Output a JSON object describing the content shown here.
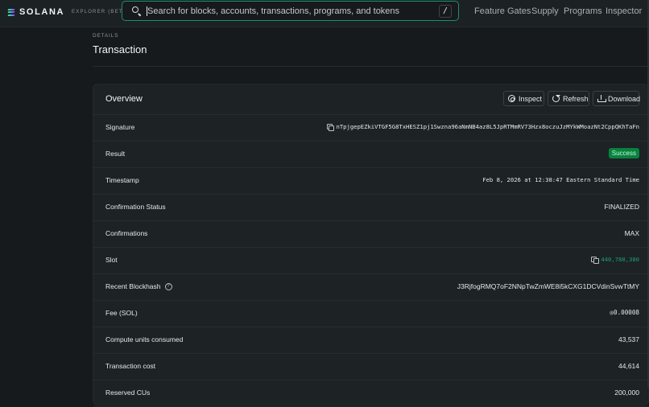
{
  "brand": {
    "name": "SOLANA",
    "sub": "EXPLORER (BETA)"
  },
  "search": {
    "placeholder": "Search for blocks, accounts, transactions, programs, and tokens",
    "shortcut": "/"
  },
  "nav": [
    {
      "label": "Feature Gates"
    },
    {
      "label": "Supply"
    },
    {
      "label": "Programs"
    },
    {
      "label": "Inspector"
    }
  ],
  "header": {
    "pretitle": "DETAILS",
    "title": "Transaction"
  },
  "card": {
    "title": "Overview",
    "buttons": {
      "inspect": "Inspect",
      "refresh": "Refresh",
      "download": "Download"
    },
    "rows": [
      {
        "label": "Signature",
        "value": "nTpjgepEZkiVTGF5G8TxHESZ1pj1Swzna96aNmNB4az8L5JpRTMmRV73Hzx8oczuJzMYkWMoazNt2CppQKhTaFn"
      },
      {
        "label": "Result",
        "value": "Success"
      },
      {
        "label": "Timestamp",
        "value": "Feb 8, 2026 at 12:38:47 Eastern Standard Time"
      },
      {
        "label": "Confirmation Status",
        "value": "FINALIZED"
      },
      {
        "label": "Confirmations",
        "value": "MAX"
      },
      {
        "label": "Slot",
        "value": "440,780,380"
      },
      {
        "label": "Recent Blockhash",
        "value": "J3RjfogRMQ7oF2NNpTwZmWE8i5kCXG1DCVdinSvwTtMY"
      },
      {
        "label": "Fee (SOL)",
        "value": "◎0.00008"
      },
      {
        "label": "Compute units consumed",
        "value": "43,537"
      },
      {
        "label": "Transaction cost",
        "value": "44,614"
      },
      {
        "label": "Reserved CUs",
        "value": "200,000"
      }
    ]
  },
  "colors": {
    "accent": "#1d9e75",
    "success_badge": "#08823f",
    "search_border": "#1f8f68"
  }
}
